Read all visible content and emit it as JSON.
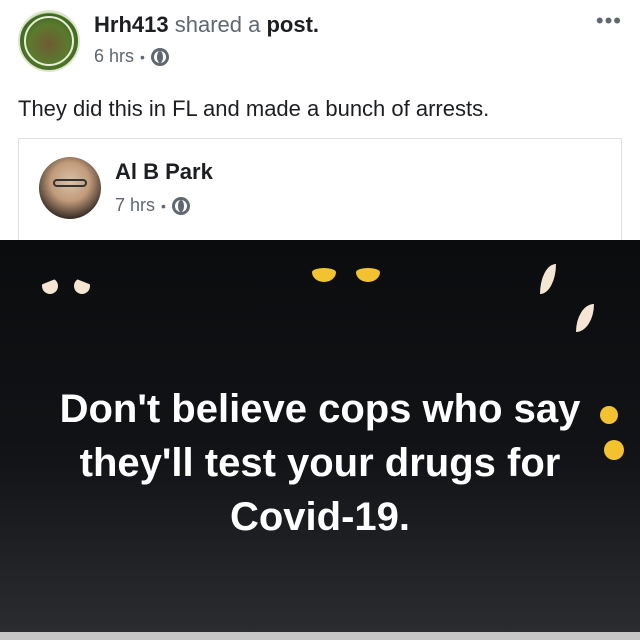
{
  "post": {
    "author": "Hrh413",
    "action_text": "shared a",
    "action_target": "post.",
    "time": "6 hrs",
    "separator": "•",
    "more_label": "•••",
    "text": "They did this in FL and made a bunch of arrests."
  },
  "shared_post": {
    "author": "Al B Park",
    "time": "7 hrs",
    "separator": "•"
  },
  "image": {
    "text_lines": [
      "Don't believe cops who say",
      "they'll test your drugs for",
      "Covid-19."
    ]
  },
  "colors": {
    "text_primary": "#1c1e21",
    "text_secondary": "#606770",
    "border": "#dddfe2",
    "image_bg": "#0b0c0e",
    "eye_yellow": "#f2c230",
    "eye_white": "#f4e6d2"
  }
}
